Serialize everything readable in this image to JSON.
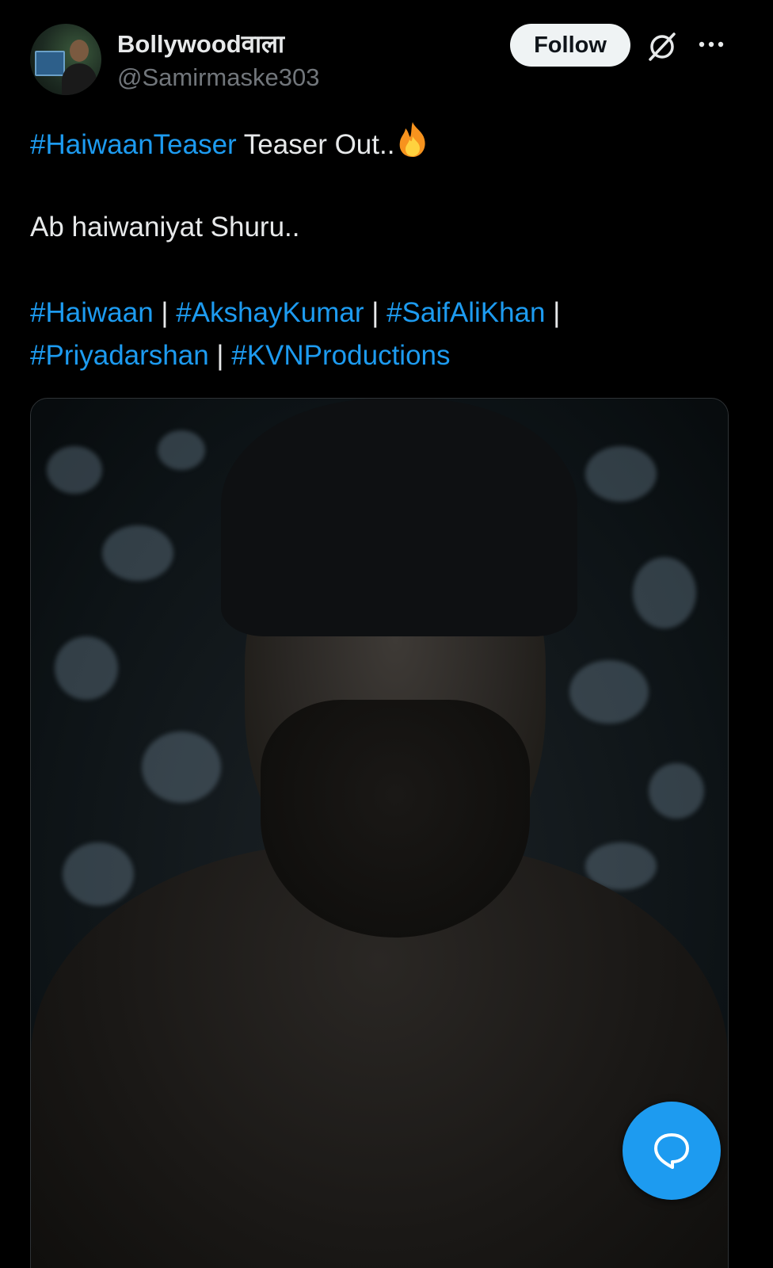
{
  "author": {
    "display_name": "Bollywoodवाला",
    "handle": "@Samirmaske303"
  },
  "actions": {
    "follow_label": "Follow",
    "grok_icon": "grok-icon",
    "more_icon": "more-icon"
  },
  "tweet": {
    "line1_hashtag": "#HaiwaanTeaser",
    "line1_text": " Teaser Out..",
    "line1_emoji": "fire-icon",
    "line2_text": "Ab haiwaniyat Shuru..",
    "hashtags_row1": [
      "#Haiwaan",
      "#AkshayKumar",
      "#SaifAliKhan"
    ],
    "hashtags_row2": [
      "#Priyadarshan",
      "#KVNProductions"
    ],
    "separator": " | "
  },
  "colors": {
    "background": "#000000",
    "text": "#e7e9ea",
    "secondary_text": "#71767b",
    "accent": "#1d9bf0",
    "follow_button_bg": "#eff3f4"
  },
  "fab": {
    "icon": "reply-bubble-icon"
  }
}
